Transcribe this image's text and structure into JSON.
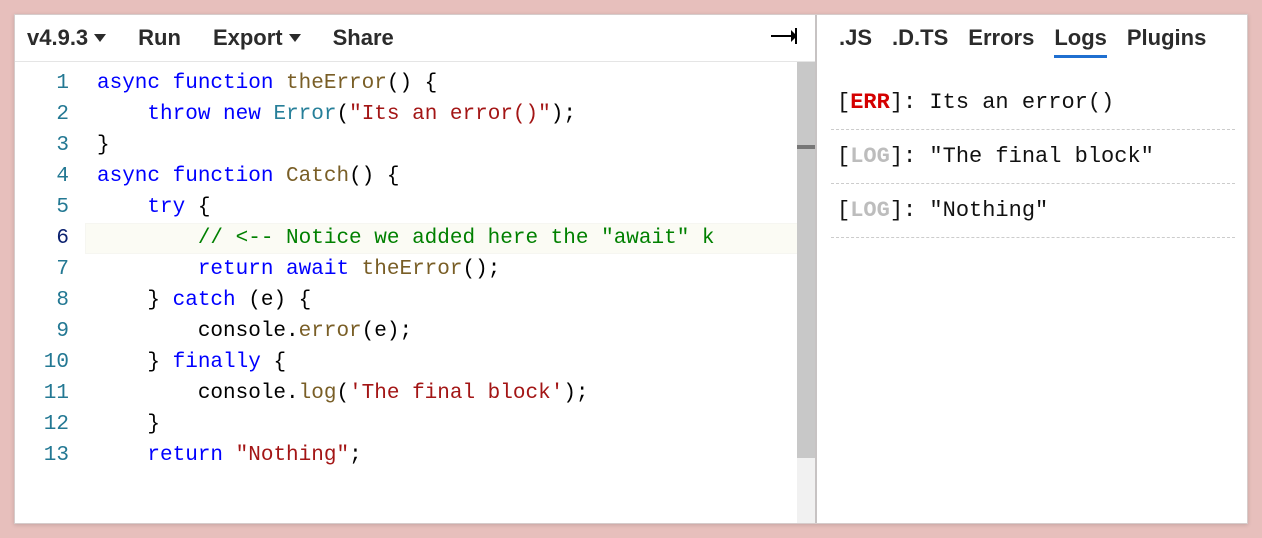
{
  "toolbar": {
    "version": "v4.9.3",
    "run": "Run",
    "export": "Export",
    "share": "Share"
  },
  "editor": {
    "activeLine": 6,
    "lines": [
      {
        "n": 1,
        "segs": [
          {
            "t": "async ",
            "c": "kw"
          },
          {
            "t": "function ",
            "c": "kw"
          },
          {
            "t": "theError",
            "c": "fn"
          },
          {
            "t": "() {",
            "c": "plain"
          }
        ]
      },
      {
        "n": 2,
        "segs": [
          {
            "t": "    ",
            "c": "plain"
          },
          {
            "t": "throw ",
            "c": "kw"
          },
          {
            "t": "new ",
            "c": "kw"
          },
          {
            "t": "Error",
            "c": "type"
          },
          {
            "t": "(",
            "c": "plain"
          },
          {
            "t": "\"Its an error()\"",
            "c": "str"
          },
          {
            "t": ");",
            "c": "plain"
          }
        ]
      },
      {
        "n": 3,
        "segs": [
          {
            "t": "}",
            "c": "plain"
          }
        ]
      },
      {
        "n": 4,
        "segs": [
          {
            "t": "async ",
            "c": "kw"
          },
          {
            "t": "function ",
            "c": "kw"
          },
          {
            "t": "Catch",
            "c": "fn"
          },
          {
            "t": "() {",
            "c": "plain"
          }
        ]
      },
      {
        "n": 5,
        "segs": [
          {
            "t": "    ",
            "c": "plain"
          },
          {
            "t": "try",
            "c": "kw"
          },
          {
            "t": " {",
            "c": "plain"
          }
        ]
      },
      {
        "n": 6,
        "segs": [
          {
            "t": "        ",
            "c": "plain"
          },
          {
            "t": "// <-- Notice we added here the \"await\" k",
            "c": "com"
          }
        ]
      },
      {
        "n": 7,
        "segs": [
          {
            "t": "        ",
            "c": "plain"
          },
          {
            "t": "return ",
            "c": "kw"
          },
          {
            "t": "await ",
            "c": "kw"
          },
          {
            "t": "theError",
            "c": "fn"
          },
          {
            "t": "();",
            "c": "plain"
          }
        ]
      },
      {
        "n": 8,
        "segs": [
          {
            "t": "    } ",
            "c": "plain"
          },
          {
            "t": "catch",
            "c": "kw"
          },
          {
            "t": " (",
            "c": "plain"
          },
          {
            "t": "e",
            "c": "plain"
          },
          {
            "t": ") {",
            "c": "plain"
          }
        ]
      },
      {
        "n": 9,
        "segs": [
          {
            "t": "        console.",
            "c": "plain"
          },
          {
            "t": "error",
            "c": "fn"
          },
          {
            "t": "(e);",
            "c": "plain"
          }
        ]
      },
      {
        "n": 10,
        "segs": [
          {
            "t": "    } ",
            "c": "plain"
          },
          {
            "t": "finally",
            "c": "kw"
          },
          {
            "t": " {",
            "c": "plain"
          }
        ]
      },
      {
        "n": 11,
        "segs": [
          {
            "t": "        console.",
            "c": "plain"
          },
          {
            "t": "log",
            "c": "fn"
          },
          {
            "t": "(",
            "c": "plain"
          },
          {
            "t": "'The final block'",
            "c": "str"
          },
          {
            "t": ");",
            "c": "plain"
          }
        ]
      },
      {
        "n": 12,
        "segs": [
          {
            "t": "    }",
            "c": "plain"
          }
        ]
      },
      {
        "n": 13,
        "segs": [
          {
            "t": "    ",
            "c": "plain"
          },
          {
            "t": "return ",
            "c": "kw"
          },
          {
            "t": "\"Nothing\"",
            "c": "str"
          },
          {
            "t": ";",
            "c": "plain"
          }
        ]
      }
    ]
  },
  "sidebar_tabs": {
    "js": ".JS",
    "dts": ".D.TS",
    "errors": "Errors",
    "logs": "Logs",
    "plugins": "Plugins",
    "active": "logs"
  },
  "logs": [
    {
      "tag": "ERR",
      "text": "Its an error()"
    },
    {
      "tag": "LOG",
      "text": "\"The final block\""
    },
    {
      "tag": "LOG",
      "text": "\"Nothing\""
    }
  ]
}
